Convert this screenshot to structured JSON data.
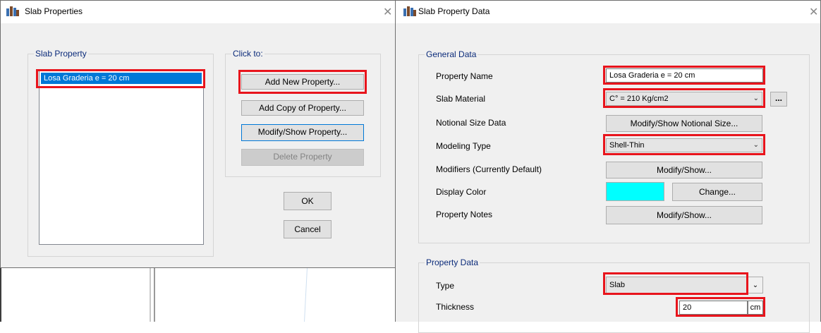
{
  "slab_properties": {
    "title": "Slab Properties",
    "close_glyph": "✕",
    "slab_property_group": "Slab Property",
    "list_items": [
      "Losa Graderia e = 20 cm"
    ],
    "click_to_group": "Click to:",
    "add_new": "Add New Property...",
    "add_copy": "Add Copy of Property...",
    "modify_show": "Modify/Show Property...",
    "delete": "Delete Property",
    "ok": "OK",
    "cancel": "Cancel"
  },
  "slab_property_data": {
    "title": "Slab Property Data",
    "close_glyph": "✕",
    "general_group": "General Data",
    "property_name_label": "Property Name",
    "property_name_value": "Losa Graderia e = 20 cm",
    "slab_material_label": "Slab Material",
    "slab_material_value": "C° = 210 Kg/cm2",
    "ellipsis": "...",
    "notional_label": "Notional Size Data",
    "notional_button": "Modify/Show Notional Size...",
    "modeling_type_label": "Modeling Type",
    "modeling_type_value": "Shell-Thin",
    "modifiers_label": "Modifiers (Currently Default)",
    "modifiers_button": "Modify/Show...",
    "display_color_label": "Display Color",
    "display_color_value": "#00ffff",
    "change_button": "Change...",
    "notes_label": "Property Notes",
    "notes_button": "Modify/Show...",
    "property_data_group": "Property Data",
    "type_label": "Type",
    "type_value": "Slab",
    "thickness_label": "Thickness",
    "thickness_value": "20",
    "thickness_unit": "cm"
  },
  "colors": {
    "highlight_box": "#e8141c",
    "selection": "#0078d7",
    "group_label": "#0b2b7a"
  }
}
